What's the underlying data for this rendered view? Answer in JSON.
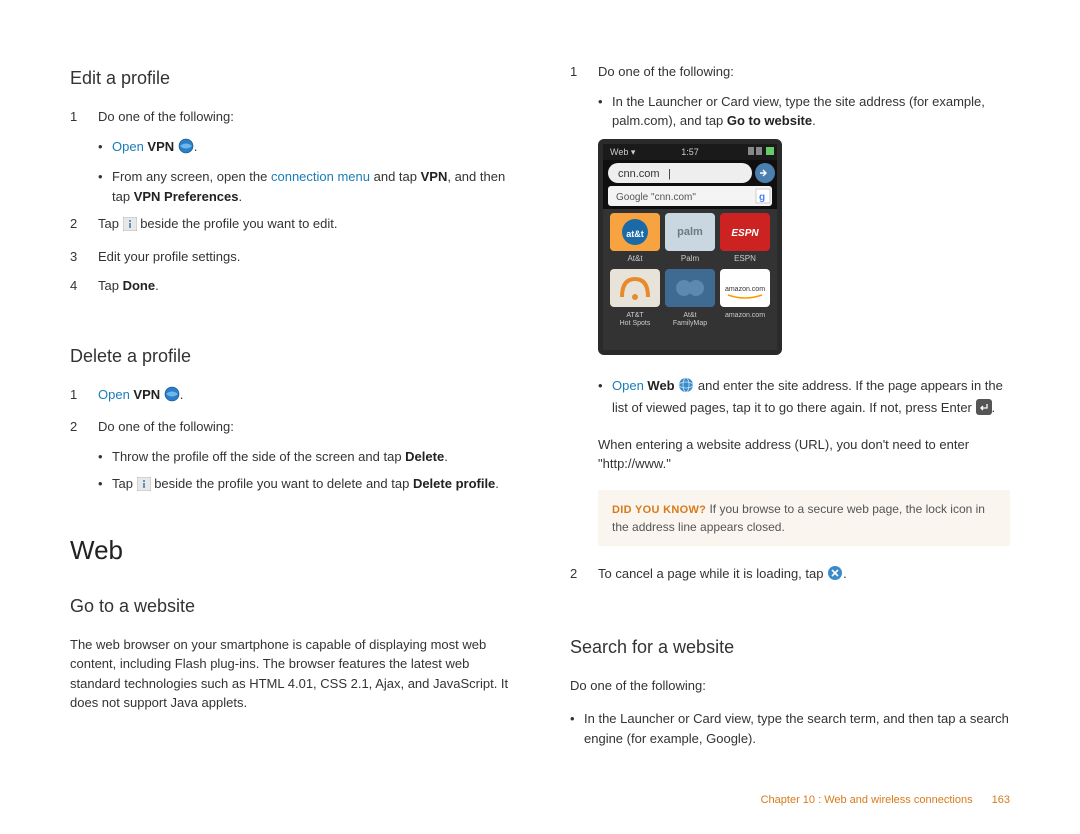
{
  "left": {
    "h_edit": "Edit a profile",
    "s1": "Do one of the following:",
    "b1a_pre": "Open ",
    "b1a_bold": "VPN",
    "b1b_pre": "From any screen, open the ",
    "b1b_link": "connection menu",
    "b1b_mid": " and tap ",
    "b1b_bold1": "VPN",
    "b1b_mid2": ", and then tap ",
    "b1b_bold2": "VPN Preferences",
    "s2_pre": "Tap ",
    "s2_post": " beside the profile you want to edit.",
    "s3": "Edit your profile settings.",
    "s4_pre": "Tap ",
    "s4_bold": "Done",
    "h_delete": "Delete a profile",
    "d1_pre": "Open ",
    "d1_bold": "VPN",
    "d2": "Do one of the following:",
    "db1_pre": "Throw the profile off the side of the screen and tap ",
    "db1_bold": "Delete",
    "db2_pre": "Tap ",
    "db2_mid": " beside the profile you want to delete and tap ",
    "db2_bold": "Delete profile",
    "h_web": "Web",
    "h_goto": "Go to a website",
    "goto_para": "The web browser on your smartphone is capable of displaying most web content, including Flash plug-ins. The browser features the latest web standard technologies such as HTML 4.01, CSS 2.1, Ajax, and JavaScript. It does not support Java applets."
  },
  "right": {
    "r1": "Do one of the following:",
    "rb1_pre": "In the Launcher or Card view, type the site address (for example, palm.com), and tap ",
    "rb1_bold": "Go to website",
    "rb2_pre": "Open ",
    "rb2_bold": "Web",
    "rb2_mid": " and enter the site address. If the page appears in the list of viewed pages, tap it to go there again. If not, press Enter ",
    "r_para": "When entering a website address (URL), you don't need to enter \"http://www.\"",
    "callout_lead": "DID YOU KNOW?",
    "callout_body": " If you browse to a secure web page, the lock icon in the address line appears closed.",
    "r2_pre": "To cancel a page while it is loading, tap ",
    "h_search": "Search for a website",
    "search_p": "Do one of the following:",
    "sb1": "In the Launcher or Card view, type the search term, and then tap a search engine (for example, Google).",
    "screenshot": {
      "header_label": "Web",
      "time": "1:57",
      "addr": "cnn.com",
      "suggest_pre": "Google ",
      "suggest_q": "\"cnn.com\"",
      "tiles": [
        "at&t",
        "palm",
        "ESPN",
        "AT&T",
        "Palm",
        "ESPN",
        "AT&T Hot Spots",
        "At&t FamilyMap",
        "amazon.com"
      ]
    }
  },
  "footer": {
    "chapter": "Chapter 10 : Web and wireless connections",
    "page": "163"
  }
}
